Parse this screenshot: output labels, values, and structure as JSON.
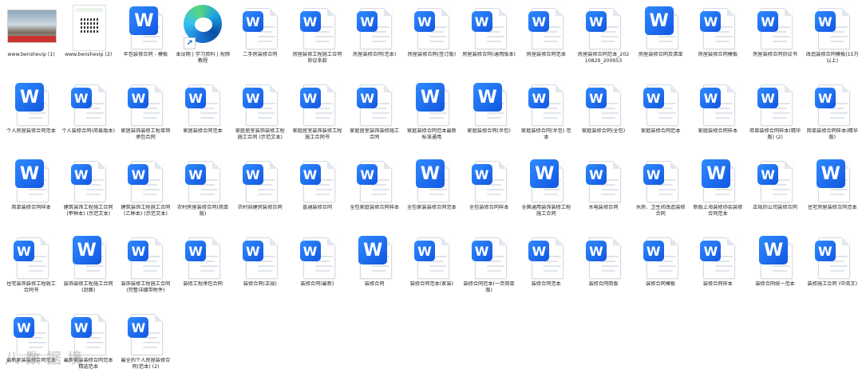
{
  "desktop": {
    "items": [
      {
        "label": "www.benshevip (1)",
        "type": "photo"
      },
      {
        "label": "www.benshevip (2)",
        "type": "qr"
      },
      {
        "label": "半包装修合同 - 模板",
        "type": "wps-big"
      },
      {
        "label": "本设网 | 学习资料 | 视频教程",
        "type": "edge"
      },
      {
        "label": "二手房装修合同",
        "type": "wps-small"
      },
      {
        "label": "房屋装修工程施工合同协议条款",
        "type": "wps-small"
      },
      {
        "label": "房屋装修合同(范本)",
        "type": "wps-small"
      },
      {
        "label": "房屋装修合同(签订版)",
        "type": "wps-small"
      },
      {
        "label": "房屋装修合同(通用版本)",
        "type": "wps-small"
      },
      {
        "label": "房屋装修合同范本",
        "type": "wps-small"
      },
      {
        "label": "房屋装修合同范本_20210829_200953",
        "type": "wps-small"
      },
      {
        "label": "房屋装修合同及清单",
        "type": "wps-big"
      },
      {
        "label": "房屋装修合同模板",
        "type": "wps-small"
      },
      {
        "label": "房屋装修合同协议书",
        "type": "wps-small"
      },
      {
        "label": "改造装修合同模板(15万以上)",
        "type": "wps-small"
      },
      {
        "label": "个人房屋装修合同范本",
        "type": "wps-big"
      },
      {
        "label": "个人装修合同(简易版本)",
        "type": "wps-small"
      },
      {
        "label": "家居装饰装修工程单项承包合同",
        "type": "wps-small"
      },
      {
        "label": "家居装修合同范本",
        "type": "wps-small"
      },
      {
        "label": "家庭居室装饰装修工程施工合同 (示范文本)",
        "type": "wps-small"
      },
      {
        "label": "家庭居室装饰装修工程施工合同书",
        "type": "wps-small"
      },
      {
        "label": "家庭居室装饰装修施工合同",
        "type": "wps-small"
      },
      {
        "label": "家庭装修合同范本最新标准通用",
        "type": "wps-big"
      },
      {
        "label": "家庭装修合同(半包)",
        "type": "wps-big"
      },
      {
        "label": "家庭装修合同(半包) 范本",
        "type": "wps-small"
      },
      {
        "label": "家庭装修合同(全包)",
        "type": "wps-small"
      },
      {
        "label": "家庭装修合同范本",
        "type": "wps-small"
      },
      {
        "label": "家庭装修合同样本",
        "type": "wps-small"
      },
      {
        "label": "简单装修合同样本(精华版) (2)",
        "type": "wps-small"
      },
      {
        "label": "简单装修合同样本(精华版)",
        "type": "wps-small"
      },
      {
        "label": "简单装修合同样本",
        "type": "wps-big"
      },
      {
        "label": "建筑装饰工程施工合同 (甲种本) (示范文本)",
        "type": "wps-small"
      },
      {
        "label": "建筑装饰工程施工合同 (乙种本) (示范文本)",
        "type": "wps-small"
      },
      {
        "label": "农村房屋装修合同(简单版)",
        "type": "wps-small"
      },
      {
        "label": "农村自建房装修合同",
        "type": "wps-small"
      },
      {
        "label": "普通装修合同",
        "type": "wps-small"
      },
      {
        "label": "全包家庭装修合同样本",
        "type": "wps-small"
      },
      {
        "label": "全包家装装修合同范本",
        "type": "wps-big"
      },
      {
        "label": "全包装修合同样本",
        "type": "wps-small"
      },
      {
        "label": "全国通用装饰装修工程施工合同",
        "type": "wps-big"
      },
      {
        "label": "水电装修合同",
        "type": "wps-small"
      },
      {
        "label": "水房、卫生间改造装修合同",
        "type": "wps-small"
      },
      {
        "label": "新版上海装修协会装修合同范本",
        "type": "wps-big"
      },
      {
        "label": "正规的公司装修合同",
        "type": "wps-small"
      },
      {
        "label": "住宅房屋装修合同范本",
        "type": "wps-big"
      },
      {
        "label": "住宅装饰装修工程施工合同书",
        "type": "wps-small"
      },
      {
        "label": "装饰装修工程施工合同 (封面)",
        "type": "wps-big"
      },
      {
        "label": "装饰装修工程施工合同(完整详细带附件)",
        "type": "wps-small"
      },
      {
        "label": "装修工程承包合同",
        "type": "wps-small"
      },
      {
        "label": "装修合同(正规)",
        "type": "wps-small"
      },
      {
        "label": "装修合同(最新)",
        "type": "wps-small"
      },
      {
        "label": "装修合同",
        "type": "wps-big"
      },
      {
        "label": "装修合同范本(家装)",
        "type": "wps-small"
      },
      {
        "label": "装修合同范本(一页简单版)",
        "type": "wps-small"
      },
      {
        "label": "装修合同范本",
        "type": "wps-small"
      },
      {
        "label": "装修合同简版",
        "type": "wps-small"
      },
      {
        "label": "装修合同模板",
        "type": "wps-small"
      },
      {
        "label": "装修合同样本",
        "type": "wps-small"
      },
      {
        "label": "装修合同统一范本",
        "type": "wps-big"
      },
      {
        "label": "装修施工合同 (中英文)",
        "type": "wps-small"
      },
      {
        "label": "最新家装装修合同范本",
        "type": "wps-small"
      },
      {
        "label": "最新家装装修合同范本精选范本",
        "type": "wps-small"
      },
      {
        "label": "最全的个人房屋装修合同(范本) (2)",
        "type": "wps-small"
      }
    ]
  },
  "watermark": "八 数 据 境",
  "icon_glyph": "W",
  "edge_arrow": "↗",
  "colors": {
    "wps_blue": "#1a6cf0",
    "label_text": "#222222"
  }
}
